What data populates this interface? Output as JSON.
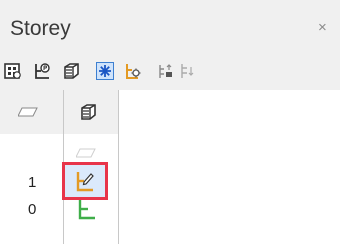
{
  "panel": {
    "title": "Storey",
    "close_glyph": "×"
  },
  "toolbar": {
    "buttons": [
      {
        "name": "building-properties-icon"
      },
      {
        "name": "storey-properties-icon"
      },
      {
        "name": "3d-view-icon"
      },
      {
        "name": "select-all-icon"
      },
      {
        "name": "storey-settings-icon"
      },
      {
        "name": "insert-storey-above-icon"
      },
      {
        "name": "insert-storey-below-icon"
      }
    ]
  },
  "grid": {
    "rows": [
      {
        "label": "1",
        "selected": true
      },
      {
        "label": "0",
        "selected": false
      }
    ]
  },
  "colors": {
    "selection_border": "#e8344a",
    "selection_fill": "#dbe9fb",
    "storey_icon_green": "#3fae49",
    "storey_icon_orange": "#e39a24"
  }
}
